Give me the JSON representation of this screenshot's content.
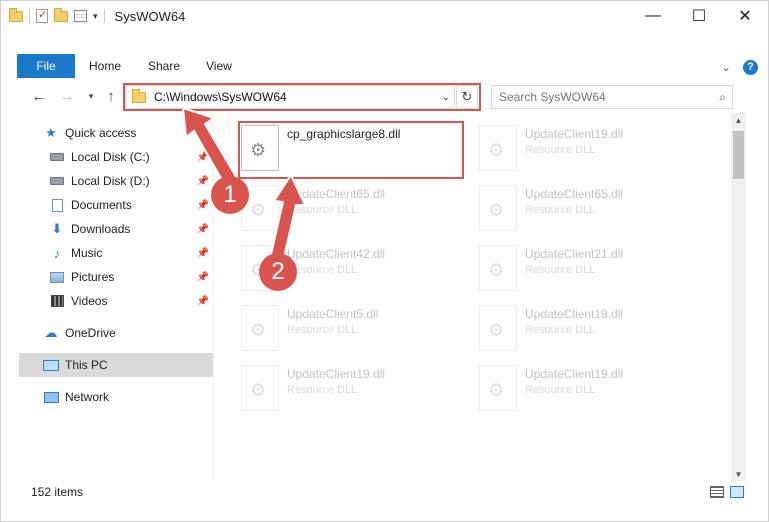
{
  "window": {
    "title": "SysWOW64",
    "controls": {
      "minimize": "—",
      "maximize": "☐",
      "close": "✕"
    }
  },
  "ribbon": {
    "tabs": [
      "File",
      "Home",
      "Share",
      "View"
    ],
    "accent": "#1979ca"
  },
  "navigation": {
    "address": "C:\\Windows\\SysWOW64",
    "search_placeholder": "Search SysWOW64"
  },
  "sidebar": {
    "items": [
      {
        "label": "Quick access",
        "icon": "star-icon",
        "pinned": false
      },
      {
        "label": "Local Disk (C:)",
        "icon": "disk-icon",
        "pinned": true
      },
      {
        "label": "Local Disk (D:)",
        "icon": "disk-icon",
        "pinned": true
      },
      {
        "label": "Documents",
        "icon": "document-icon",
        "pinned": true
      },
      {
        "label": "Downloads",
        "icon": "download-icon",
        "pinned": true
      },
      {
        "label": "Music",
        "icon": "music-icon",
        "pinned": true
      },
      {
        "label": "Pictures",
        "icon": "pictures-icon",
        "pinned": true
      },
      {
        "label": "Videos",
        "icon": "video-icon",
        "pinned": true
      },
      {
        "label": "OneDrive",
        "icon": "cloud-icon",
        "pinned": false
      },
      {
        "label": "This PC",
        "icon": "computer-icon",
        "pinned": false,
        "selected": true
      },
      {
        "label": "Network",
        "icon": "network-icon",
        "pinned": false
      }
    ]
  },
  "files": [
    {
      "name": "cp_graphicslarge8.dll",
      "type": "",
      "highlighted": true
    },
    {
      "name": "UpdateClient19.dll",
      "type": "Resource DLL"
    },
    {
      "name": "UpdateClient65.dll",
      "type": "Resource DLL"
    },
    {
      "name": "UpdateClient65.dll",
      "type": "Resource DLL"
    },
    {
      "name": "UpdateClient42.dll",
      "type": "Resource DLL"
    },
    {
      "name": "UpdateClient21.dll",
      "type": "Resource DLL"
    },
    {
      "name": "UpdateClient5.dll",
      "type": "Resource DLL"
    },
    {
      "name": "UpdateClient19.dll",
      "type": "Resource DLL"
    },
    {
      "name": "UpdateClient19.dll",
      "type": "Resource DLL"
    },
    {
      "name": "UpdateClient19.dll",
      "type": "Resource DLL"
    }
  ],
  "status": {
    "item_count": "152 items"
  },
  "annotations": {
    "step1": "1",
    "step2": "2",
    "color": "#d9534f"
  }
}
